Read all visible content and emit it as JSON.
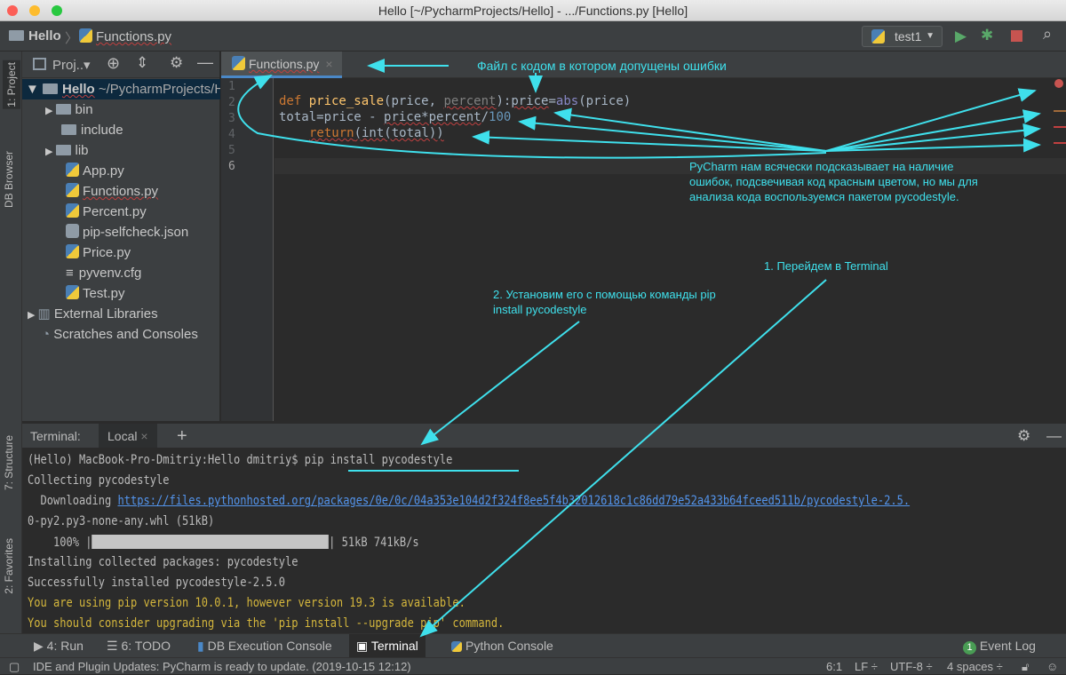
{
  "window": {
    "title": "Hello [~/PycharmProjects/Hello] - .../Functions.py [Hello]"
  },
  "nav": {
    "project": "Hello",
    "file": "Functions.py",
    "run_config": "test1"
  },
  "left_strip": {
    "project": "1: Project",
    "db": "DB Browser",
    "structure": "7: Structure",
    "favorites": "2: Favorites"
  },
  "project_panel": {
    "title": "Proj..▾",
    "items": [
      {
        "label": "Hello",
        "suffix": "~/PycharmProjects/Hello",
        "type": "folder-open"
      },
      {
        "label": "bin",
        "type": "folder"
      },
      {
        "label": "include",
        "type": "folder"
      },
      {
        "label": "lib",
        "type": "folder"
      },
      {
        "label": "App.py",
        "type": "py"
      },
      {
        "label": "Functions.py",
        "type": "py"
      },
      {
        "label": "Percent.py",
        "type": "py"
      },
      {
        "label": "pip-selfcheck.json",
        "type": "json"
      },
      {
        "label": "Price.py",
        "type": "py"
      },
      {
        "label": "pyvenv.cfg",
        "type": "cfg"
      },
      {
        "label": "Test.py",
        "type": "py"
      },
      {
        "label": "External Libraries",
        "type": "lib"
      },
      {
        "label": "Scratches and Consoles",
        "type": "scratch"
      }
    ]
  },
  "editor": {
    "tab": "Functions.py",
    "line_numbers": [
      "1",
      "2",
      "3",
      "4",
      "5",
      "6"
    ],
    "code": {
      "l2_def": "def ",
      "l2_fn": "price_sale",
      "l2_a": "(price, ",
      "l2_b": "percent",
      "l2_c": "):",
      "l2_d": "price",
      "l2_e": "=",
      "l2_f": "abs",
      "l2_g": "(price)",
      "l3_a": "total",
      "l3_b": "=price - ",
      "l3_c": "price*percent",
      "l3_d": "/",
      "l3_e": "100",
      "l4_a": "return",
      "l4_b": "(int(total))"
    }
  },
  "terminal": {
    "title": "Terminal:",
    "tab": "Local",
    "lines": [
      "(Hello) MacBook-Pro-Dmitriy:Hello dmitriy$ pip install pycodestyle",
      "Collecting pycodestyle",
      "  Downloading ",
      "https://files.pythonhosted.org/packages/0e/0c/04a353e104d2f324f8ee5f4b32012618c1c86dd79e52a433b64fceed511b/pycodestyle-2.5.",
      "0-py2.py3-none-any.whl (51kB)",
      "    100% |",
      "| 51kB 741kB/s",
      "Installing collected packages: pycodestyle",
      "Successfully installed pycodestyle-2.5.0",
      "You are using pip version 10.0.1, however version 19.3 is available.",
      "You should consider upgrading via the 'pip install --upgrade pip' command."
    ],
    "progress_percent": 100
  },
  "tool_tabs": {
    "run": "4: Run",
    "todo": "6: TODO",
    "db": "DB Execution Console",
    "terminal": "Terminal",
    "python": "Python Console",
    "event_count": "1",
    "event_log": "Event Log"
  },
  "status": {
    "message": "IDE and Plugin Updates: PyCharm is ready to update. (2019-10-15 12:12)",
    "position": "6:1",
    "line_sep": "LF ÷",
    "encoding": "UTF-8 ÷",
    "indent": "4 spaces ÷"
  },
  "annotations": {
    "file": "Файл с кодом в котором допущены ошибки",
    "hint": "PyCharm нам всячески подсказывает на наличие ошибок, подсвечивая код красным цветом, но мы для анализа кода воспользуемся пакетом pycodestyle.",
    "step1": "1. Перейдем в Terminal",
    "step2": "2. Установим его с помощью команды pip install pycodestyle"
  },
  "colors": {
    "accent": "#3fe0ec",
    "error": "#c04040",
    "keyword": "#cc7832",
    "warning": "#d4b63c"
  }
}
